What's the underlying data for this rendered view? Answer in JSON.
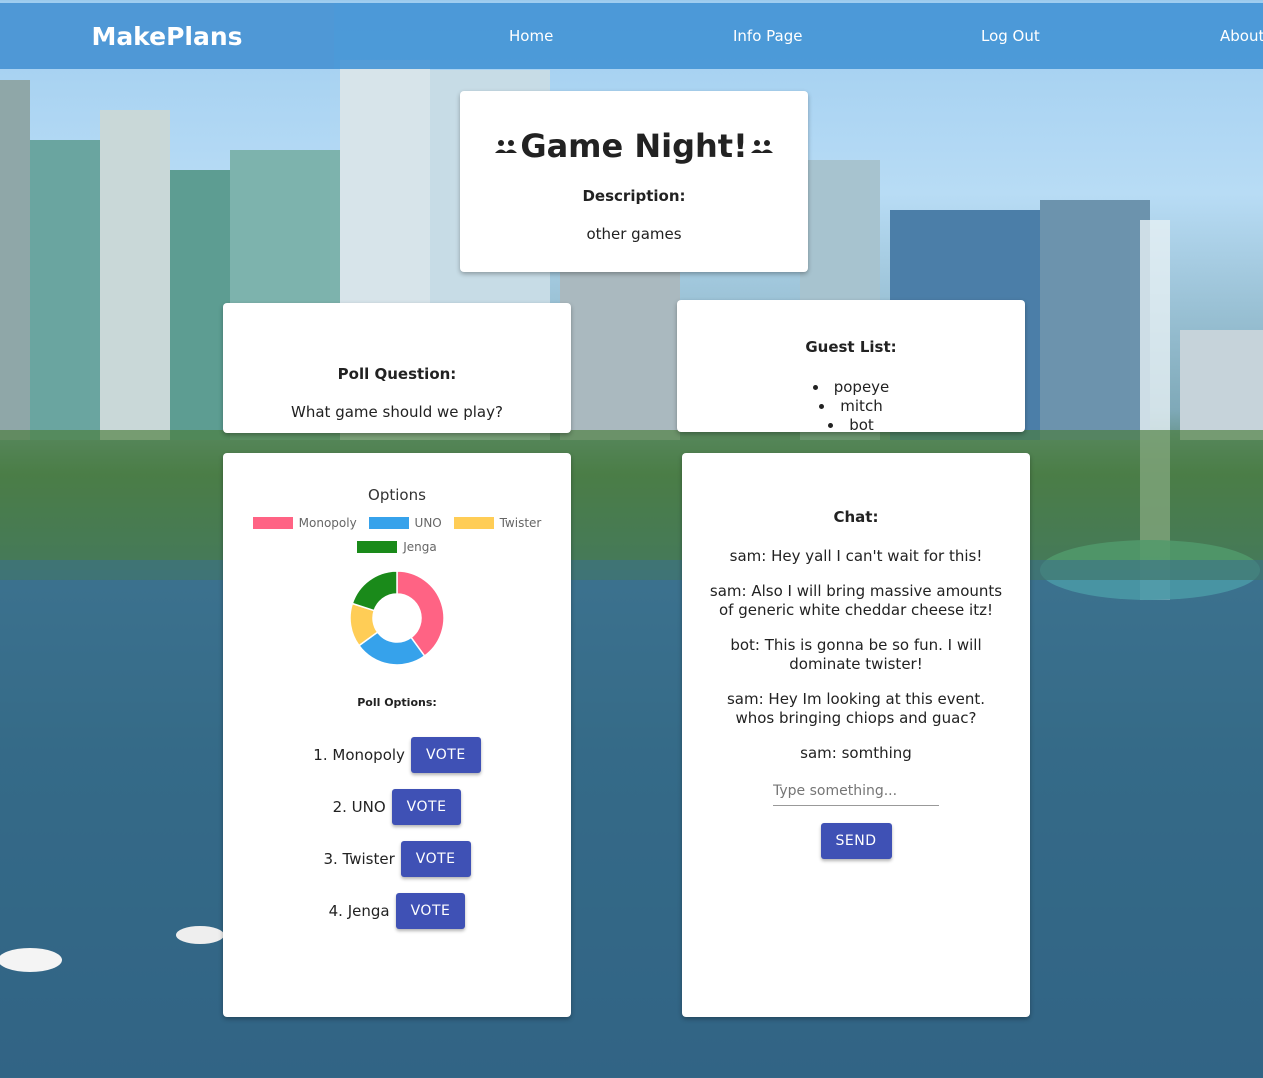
{
  "navbar": {
    "brand": "MakePlans",
    "links": [
      "Home",
      "Info Page",
      "Log Out",
      "About"
    ]
  },
  "event": {
    "title": "Game Night!",
    "description_label": "Description:",
    "description": "other games"
  },
  "poll": {
    "question_label": "Poll Question:",
    "question": "What game should we play?"
  },
  "guests": {
    "label": "Guest List:",
    "items": [
      "popeye",
      "mitch",
      "bot"
    ]
  },
  "chart_data": {
    "type": "pie",
    "title": "Options",
    "categories": [
      "Monopoly",
      "UNO",
      "Twister",
      "Jenga"
    ],
    "values": [
      40,
      25,
      15,
      20
    ],
    "colors": [
      "#ff6384",
      "#36a2eb",
      "#ffcd56",
      "#1a8a1a"
    ],
    "legend_position": "top",
    "doughnut": true
  },
  "poll_options": {
    "label": "Poll Options:",
    "items": [
      {
        "label": "1. Monopoly",
        "button": "VOTE"
      },
      {
        "label": "2. UNO",
        "button": "VOTE"
      },
      {
        "label": "3. Twister",
        "button": "VOTE"
      },
      {
        "label": "4. Jenga",
        "button": "VOTE"
      }
    ]
  },
  "chat": {
    "label": "Chat:",
    "messages": [
      "sam: Hey yall I can't wait for this!",
      "sam: Also I will bring massive amounts of generic white cheddar cheese itz!",
      "bot: This is gonna be so fun. I will dominate twister!",
      "sam: Hey Im looking at this event. whos bringing chiops and guac?",
      "sam: somthing"
    ],
    "input_placeholder": "Type something...",
    "send_button": "SEND"
  },
  "colors": {
    "navbar": "#3e90d4",
    "button": "#3f51b5"
  }
}
